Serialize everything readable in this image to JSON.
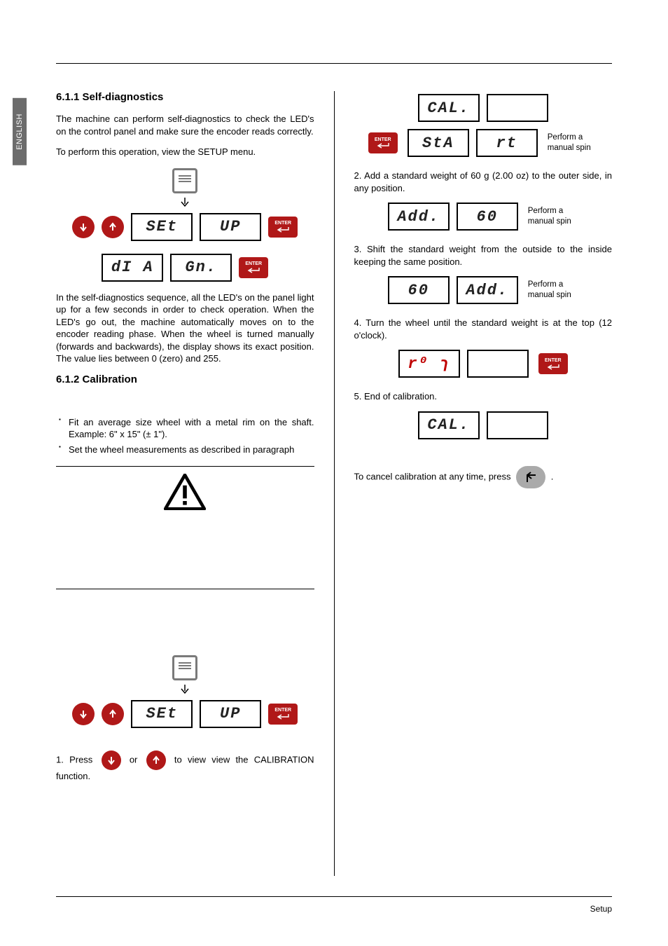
{
  "language_tab": "ENGLISH",
  "footer": "Setup",
  "left": {
    "h_6_1_1": "6.1.1   Self-diagnostics",
    "p1": "The machine can perform self-diagnostics to check the LED's on the control panel and make sure the encoder reads correctly.",
    "p2": "To perform this operation, view the SETUP menu.",
    "set_label": "SEt",
    "up_label": "UP",
    "dia_label": "dI A",
    "gn_label": "Gn.",
    "p3": "In the self-diagnostics sequence, all the LED's on the panel light up for a few seconds in order to check operation. When the LED's go out, the machine automatically moves on to the encoder reading phase. When the wheel is turned manually (forwards and backwards), the display shows its exact position. The value lies between 0 (zero) and 255.",
    "h_6_1_2": "6.1.2   Calibration",
    "bullet1": "Fit an average size wheel with a metal rim on the shaft. Example: 6\" x 15\" (± 1\").",
    "bullet2": "Set the wheel measurements as described in paragraph",
    "step1_prefix": "1.   Press",
    "step1_mid": "or",
    "step1_suffix": "to view view the CALIBRATION function.",
    "enter_label": "ENTER"
  },
  "right": {
    "cal_label": "CAL.",
    "sta_label": "StA",
    "rt_label": "rt",
    "spin_note": "Perform a manual spin",
    "step2": "2.   Add a standard weight of 60 g (2.00 oz) to the outer side, in any position.",
    "add_label": "Add.",
    "sixty_label": "60",
    "step3": "3.   Shift the standard weight from the outside to the inside keeping the same position.",
    "step4": "4.   Turn the wheel until the standard weight is at the top (12 o'clock).",
    "ro_label": "r⁰ ɿ",
    "step5": "5.   End of calibration.",
    "cancel_prefix": "To cancel calibration at any time, press",
    "cancel_suffix": ".",
    "enter_label": "ENTER"
  }
}
